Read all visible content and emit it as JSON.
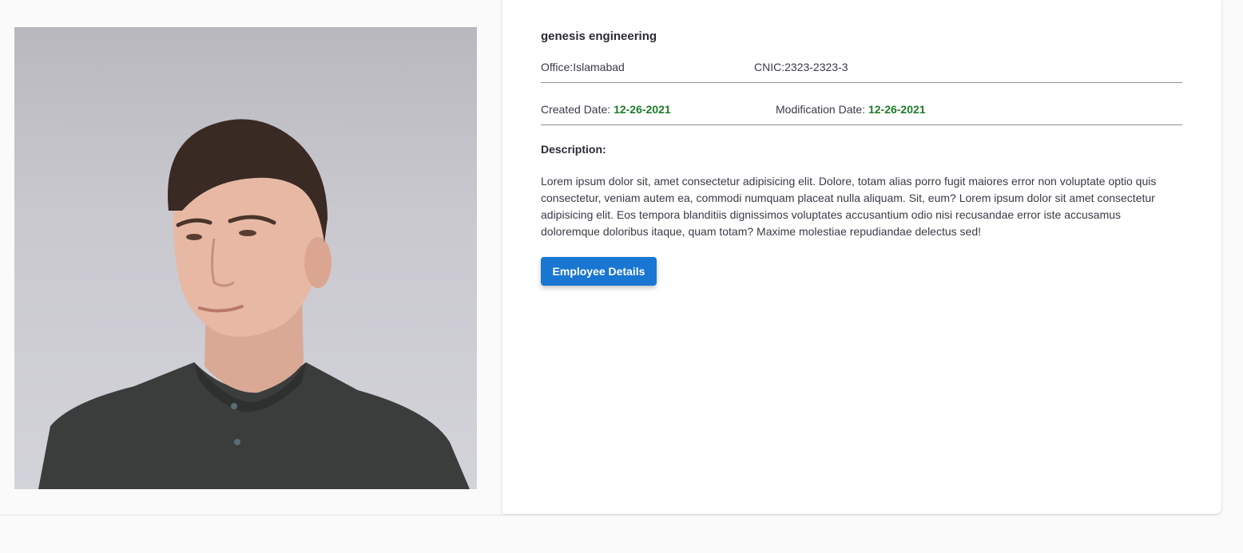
{
  "profile": {
    "name": "genesis engineering",
    "office_label": "Office:",
    "office_value": "Islamabad",
    "cnic_label": "CNIC:",
    "cnic_value": "2323-2323-3",
    "created_label": "Created Date:",
    "created_value": "12-26-2021",
    "modified_label": "Modification Date:",
    "modified_value": "12-26-2021",
    "description_label": "Description:",
    "description_text": "Lorem ipsum dolor sit, amet consectetur adipisicing elit. Dolore, totam alias porro fugit maiores error non voluptate optio quis consectetur, veniam autem ea, commodi numquam placeat nulla aliquam. Sit, eum? Lorem ipsum dolor sit amet consectetur adipisicing elit. Eos tempora blanditiis dignissimos voluptates accusantium odio nisi recusandae error iste accusamus doloremque doloribus itaque, quam totam? Maxime molestiae repudiandae delectus sed!",
    "button_label": "Employee Details"
  },
  "colors": {
    "accent": "#1976d2",
    "date_green": "#1f7a2a"
  }
}
